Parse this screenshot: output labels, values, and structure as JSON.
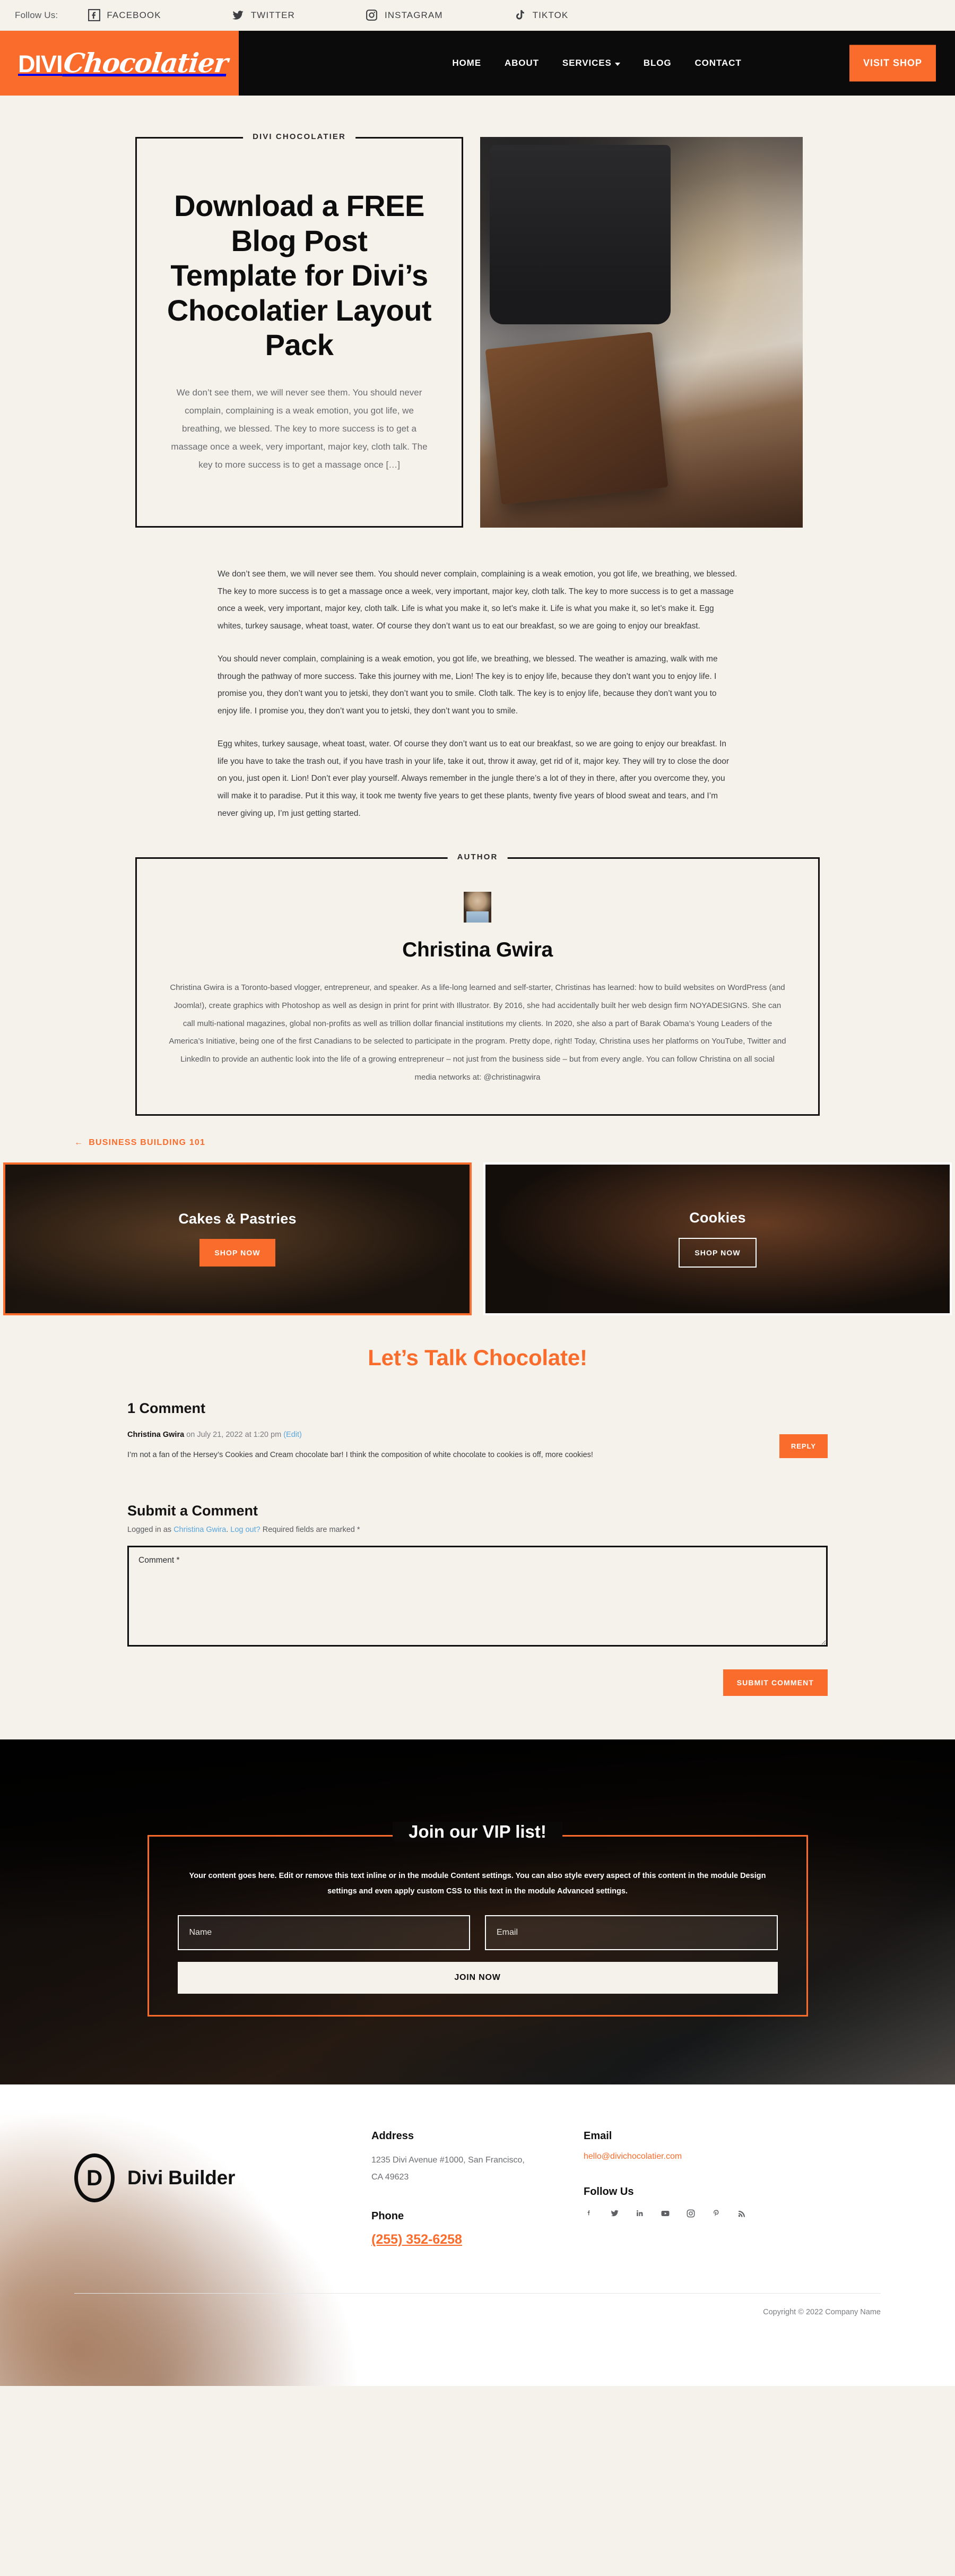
{
  "topbar": {
    "follow_label": "Follow Us:",
    "socials": [
      {
        "name": "FACEBOOK",
        "icon": "facebook-icon"
      },
      {
        "name": "TWITTER",
        "icon": "twitter-icon"
      },
      {
        "name": "INSTAGRAM",
        "icon": "instagram-icon"
      },
      {
        "name": "TIKTOK",
        "icon": "tiktok-icon"
      }
    ]
  },
  "header": {
    "logo_primary": "DIVI",
    "logo_script": "Chocolatier",
    "nav": [
      {
        "label": "HOME",
        "has_dropdown": false
      },
      {
        "label": "ABOUT",
        "has_dropdown": false
      },
      {
        "label": "SERVICES",
        "has_dropdown": true
      },
      {
        "label": "BLOG",
        "has_dropdown": false
      },
      {
        "label": "CONTACT",
        "has_dropdown": false
      }
    ],
    "cta_label": "VISIT SHOP",
    "accent_color": "#f96c2b",
    "bar_color": "#0b0b0b"
  },
  "hero": {
    "category": "DIVI CHOCOLATIER",
    "title": "Download a FREE Blog Post Template for Divi’s Chocolatier Layout Pack",
    "excerpt": "We don’t see them, we will never see them. You should never complain, complaining is a weak emotion, you got life, we breathing, we blessed. The key to more success is to get a massage once a week, very important, major key, cloth talk. The key to more success is to get a massage once […]",
    "image_alt": "chocolate bars with cocoa powder and saucepan"
  },
  "article": {
    "paragraphs": [
      "We don’t see them, we will never see them. You should never complain, complaining is a weak emotion, you got life, we breathing, we blessed. The key to more success is to get a massage once a week, very important, major key, cloth talk. The key to more success is to get a massage once a week, very important, major key, cloth talk. Life is what you make it, so let’s make it. Life is what you make it, so let’s make it. Egg whites, turkey sausage, wheat toast, water. Of course they don’t want us to eat our breakfast, so we are going to enjoy our breakfast.",
      "You should never complain, complaining is a weak emotion, you got life, we breathing, we blessed. The weather is amazing, walk with me through the pathway of more success. Take this journey with me, Lion! The key is to enjoy life, because they don’t want you to enjoy life. I promise you, they don’t want you to jetski, they don’t want you to smile. Cloth talk. The key is to enjoy life, because they don’t want you to enjoy life. I promise you, they don’t want you to jetski, they don’t want you to smile.",
      "Egg whites, turkey sausage, wheat toast, water. Of course they don’t want us to eat our breakfast, so we are going to enjoy our breakfast. In life you have to take the trash out, if you have trash in your life, take it out, throw it away, get rid of it, major key. They will try to close the door on you, just open it. Lion! Don’t ever play yourself. Always remember in the jungle there’s a lot of they in there, after you overcome they, you will make it to paradise. Put it this way, it took me twenty five years to get these plants, twenty five years of blood sweat and tears, and I’m never giving up, I’m just getting started."
    ]
  },
  "author": {
    "label": "AUTHOR",
    "name": "Christina Gwira",
    "avatar_alt": "Christina Gwira portrait",
    "bio": "Christina Gwira is a Toronto-based vlogger, entrepreneur, and speaker. As a life-long learned and self-starter, Christinas has learned: how to build websites on WordPress (and Joomla!), create graphics with Photoshop as well as design in print for print with Illustrator. By 2016, she had accidentally built her web design firm NOYADESIGNS. She can call multi-national magazines, global non-profits as well as trillion dollar financial institutions my clients. In 2020, she also a part of Barak Obama’s Young Leaders of the America’s Initiative, being one of the first Canadians to be selected to participate in the program. Pretty dope, right! Today, Christina uses her platforms on YouTube, Twitter and LinkedIn to provide an authentic look into the life of a growing entrepreneur – not just from the business side – but from every angle. You can follow Christina on all social media networks at: @christinagwira"
  },
  "prev_post": {
    "arrow": "←",
    "label": "BUSINESS BUILDING 101"
  },
  "promos": [
    {
      "title": "Cakes & Pastries",
      "button": "SHOP NOW",
      "style": "filled",
      "border_color": "#f96c2b"
    },
    {
      "title": "Cookies",
      "button": "SHOP NOW",
      "style": "outline",
      "border_color": "#ffffff"
    }
  ],
  "comments": {
    "section_title": "Let’s Talk Chocolate!",
    "count_label": "1 Comment",
    "items": [
      {
        "author": "Christina Gwira",
        "meta": " on July 21, 2022 at 1:20 pm ",
        "edit_label": "(Edit)",
        "text": "I’m not a fan of the Hersey’s Cookies and Cream chocolate bar! I think the composition of white chocolate to cookies is off, more cookies!",
        "reply_label": "REPLY"
      }
    ],
    "form": {
      "heading": "Submit a Comment",
      "logged_in_prefix": "Logged in as ",
      "logged_in_user": "Christina Gwira",
      "logged_in_sep": ". ",
      "logout_label": "Log out?",
      "required_note": " Required fields are marked *",
      "comment_placeholder": "Comment *",
      "comment_value": "",
      "submit_label": "SUBMIT COMMENT"
    }
  },
  "optin": {
    "title": "Join our VIP list!",
    "body": "Your content goes here. Edit or remove this text inline or in the module Content settings. You can also style every aspect of this content in the module Design settings and even apply custom CSS to this text in the module Advanced settings.",
    "name_placeholder": "Name",
    "name_value": "",
    "email_placeholder": "Email",
    "email_value": "",
    "submit_label": "JOIN NOW",
    "border_color": "#f96c2b"
  },
  "footer": {
    "brand_mark": "D",
    "brand_name": "Divi Builder",
    "address_head": "Address",
    "address_text": "1235 Divi Avenue #1000, San Francisco, CA 49623",
    "phone_head": "Phone",
    "phone_value": "(255) 352-6258",
    "email_head": "Email",
    "email_value": "hello@divichocolatier.com",
    "follow_head": "Follow Us",
    "socials": [
      {
        "name": "facebook-icon"
      },
      {
        "name": "twitter-icon"
      },
      {
        "name": "linkedin-icon"
      },
      {
        "name": "youtube-icon"
      },
      {
        "name": "instagram-icon"
      },
      {
        "name": "pinterest-icon"
      },
      {
        "name": "rss-icon"
      }
    ],
    "copyright": "Copyright © 2022 Company Name"
  }
}
